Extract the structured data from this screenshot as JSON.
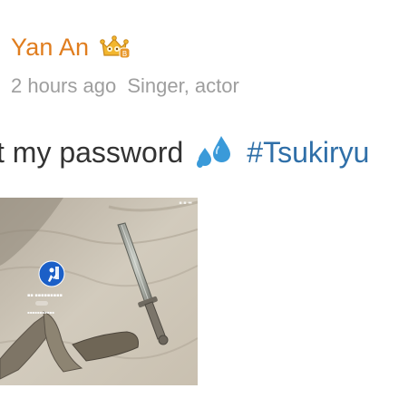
{
  "post": {
    "author": {
      "name": "Yan An",
      "badge_icon": "vip-crown-icon",
      "name_color": "#e07d1e"
    },
    "meta": {
      "time": "2 hours ago",
      "bio": "Singer, actor"
    },
    "content": {
      "text": "t my password",
      "emoji_icon": "sweat-droplets-icon",
      "hashtag": "#Tsukiryu",
      "hashtag_color": "#2f6fa8"
    },
    "image": {
      "description_icon": "lock-screen-photo",
      "status_icons": "▪ ▪ ▬"
    }
  }
}
